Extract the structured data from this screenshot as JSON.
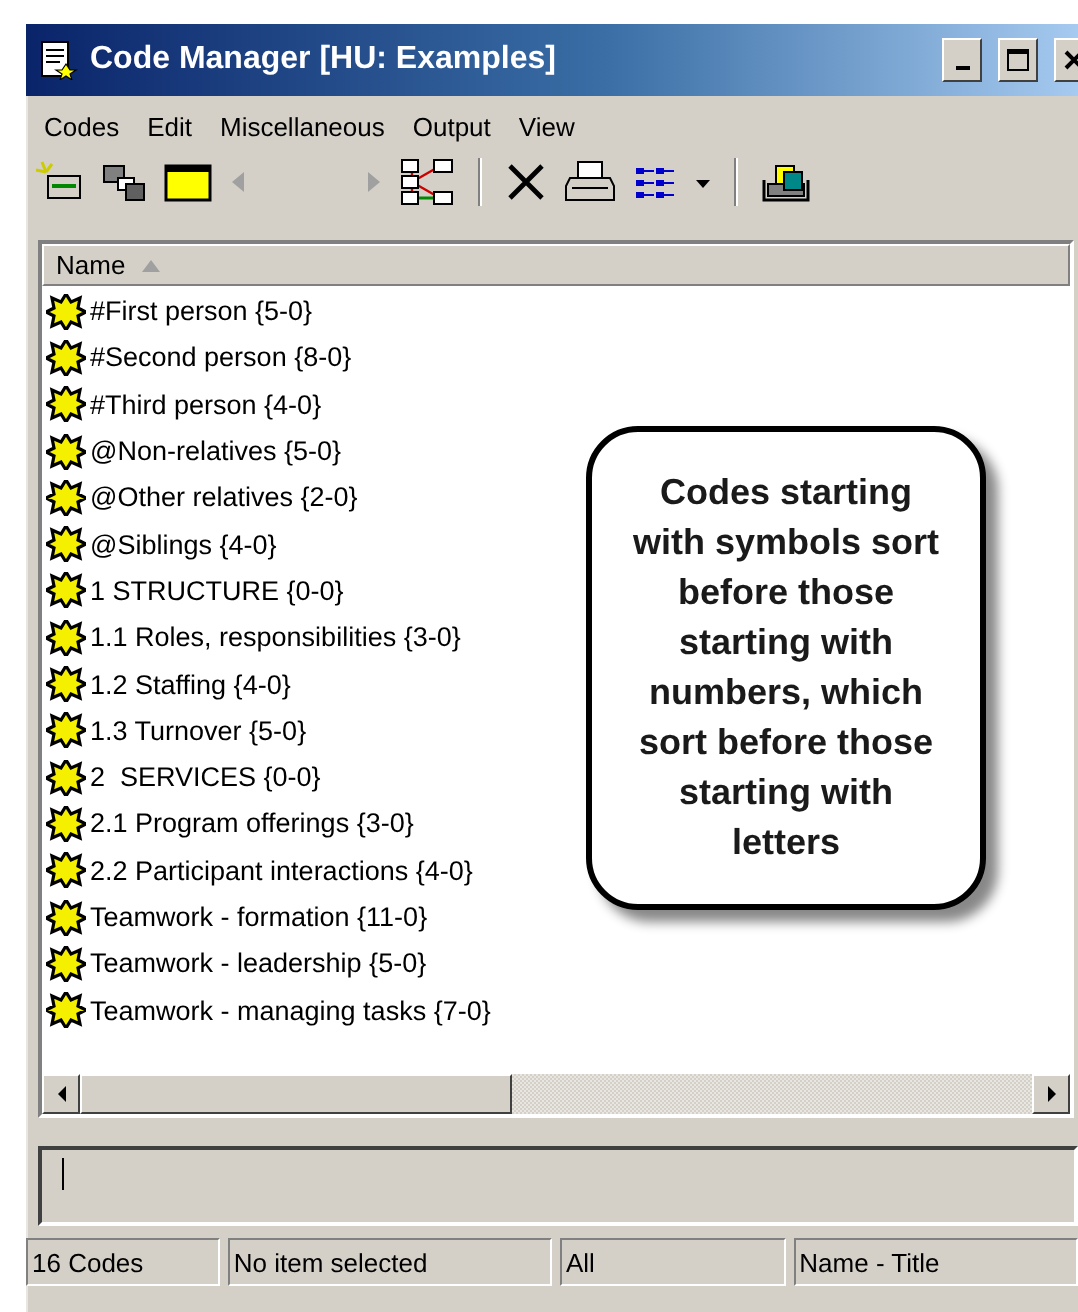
{
  "window": {
    "title": "Code Manager [HU: Examples]"
  },
  "menu": [
    "Codes",
    "Edit",
    "Miscellaneous",
    "Output",
    "View"
  ],
  "list": {
    "header": "Name",
    "items": [
      "#First person {5-0}",
      "#Second person {8-0}",
      "#Third person {4-0}",
      "@Non-relatives {5-0}",
      "@Other relatives {2-0}",
      "@Siblings {4-0}",
      "1 STRUCTURE {0-0}",
      "1.1 Roles, responsibilities {3-0}",
      "1.2 Staffing {4-0}",
      "1.3 Turnover {5-0}",
      "2  SERVICES {0-0}",
      "2.1 Program offerings {3-0}",
      "2.2 Participant interactions {4-0}",
      "Teamwork - formation {11-0}",
      "Teamwork - leadership {5-0}",
      "Teamwork - managing tasks {7-0}"
    ]
  },
  "callout": "Codes starting with symbols sort before those starting with numbers, which sort before those starting with letters",
  "status_bar": [
    "16 Codes",
    "No item selected",
    "All",
    "Name - Title"
  ]
}
